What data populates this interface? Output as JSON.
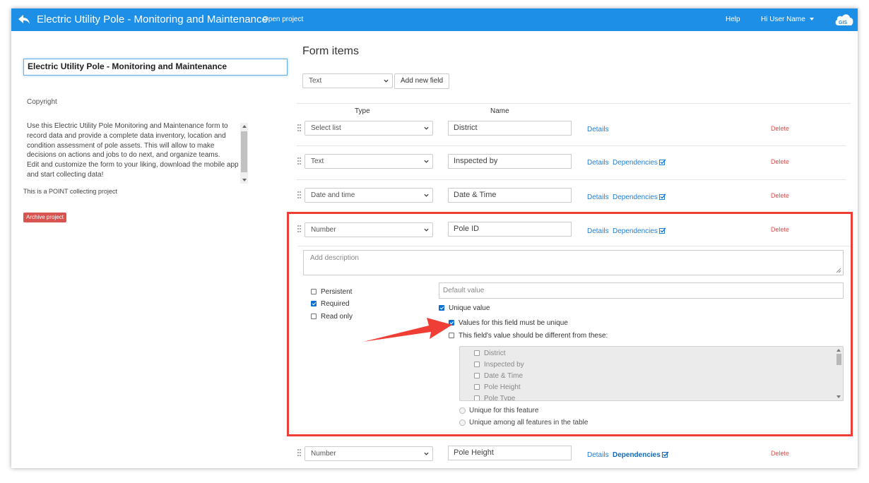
{
  "header": {
    "title": "Electric Utility Pole - Monitoring and Maintenance",
    "open_project": "Open project",
    "help": "Help",
    "user": "Hi User Name",
    "logo_text": "GIS"
  },
  "project": {
    "name": "Electric Utility Pole - Monitoring and Maintenance",
    "copyright": "Copyright",
    "description_lines": [
      "Use this Electric Utility Pole Monitoring and Maintenance form to",
      "record data and provide a complete data inventory, location and",
      "condition assessment of pole assets. This will allow to make",
      "decisions on actions and jobs to do next, and organize teams.",
      "Edit and customize the form to your liking, download the mobile app",
      "and start collecting data!"
    ],
    "collecting_type": "This is a POINT collecting project",
    "archive_label": "Archive project"
  },
  "form": {
    "title": "Form items",
    "new_field_type": "Text",
    "add_field_label": "Add new field",
    "col_type": "Type",
    "col_name": "Name",
    "details_label": "Details",
    "dependencies_label": "Dependencies",
    "delete_label": "Delete",
    "fields": [
      {
        "type": "Select list",
        "name": "District",
        "dependencies": false
      },
      {
        "type": "Text",
        "name": "Inspected by",
        "dependencies": true
      },
      {
        "type": "Date and time",
        "name": "Date & Time",
        "dependencies": true
      },
      {
        "type": "Number",
        "name": "Pole ID",
        "dependencies": true
      },
      {
        "type": "Number",
        "name": "Pole Height",
        "dependencies": true
      }
    ]
  },
  "detail": {
    "description_placeholder": "Add description",
    "default_placeholder": "Default value",
    "persistent": {
      "label": "Persistent",
      "checked": false
    },
    "required": {
      "label": "Required",
      "checked": true
    },
    "read_only": {
      "label": "Read only",
      "checked": false
    },
    "unique_value": {
      "label": "Unique value",
      "checked": true
    },
    "must_be_unique": {
      "label": "Values for this field must be unique",
      "checked": true
    },
    "different_from": {
      "label": "This field's value should be different from these:",
      "checked": false
    },
    "other_fields": [
      "District",
      "Inspected by",
      "Date & Time",
      "Pole Height",
      "Pole Type"
    ],
    "unique_feature": "Unique for this feature",
    "unique_table": "Unique among all features in the table"
  },
  "colors": {
    "topbar": "#1e8fe6",
    "highlight": "#ef3e36",
    "link": "#1e7fd6",
    "delete": "#d9534f",
    "checkbox": "#0b6fd6"
  }
}
